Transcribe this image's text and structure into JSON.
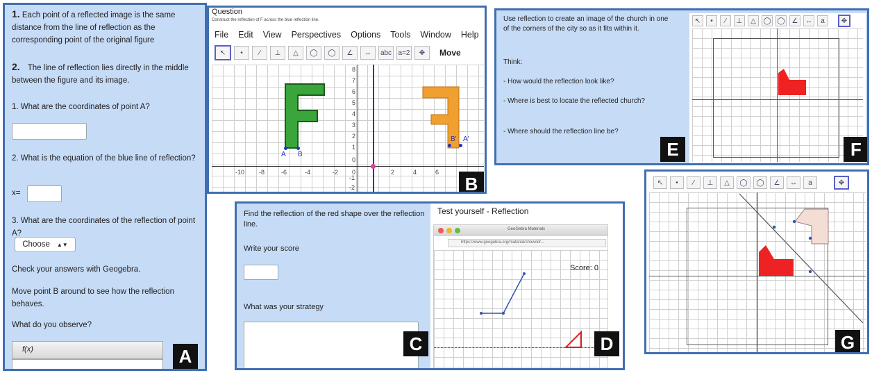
{
  "panelA": {
    "rule1": "Each point of a reflected image is the same distance from the line of reflection as the corresponding point of the original figure",
    "rule1_num": "1.",
    "rule2": "The line of reflection lies directly in the middle between the figure and its image.",
    "rule2_num": "2.",
    "q1": "1. What are the coordinates of point A?",
    "q2": "2. What is the equation of the blue line of reflection?",
    "q2_prefix": "x=",
    "q3": "3. What are the coordinates of the reflection of point A?",
    "choose": "Choose",
    "check": "Check your answers with Geogebra.",
    "move": "Move point B around to see how the reflection behaves.",
    "observe": "What do you observe?",
    "fx": "f(x)",
    "label": "A"
  },
  "panelB": {
    "title": "Question",
    "subtitle": "Construct the reflection of F across the blue reflection line.",
    "menu": [
      "File",
      "Edit",
      "View",
      "Perspectives",
      "Options",
      "Tools",
      "Window",
      "Help"
    ],
    "move_label": "Move",
    "x_ticks": [
      "-10",
      "-8",
      "-6",
      "-4",
      "-2",
      "0",
      "2",
      "4",
      "6"
    ],
    "y_ticks": [
      "8",
      "7",
      "6",
      "5",
      "4",
      "3",
      "2",
      "1",
      "0",
      "-1",
      "-2"
    ],
    "point_A": "A",
    "point_B": "B",
    "point_B_prime": "B'",
    "point_A_prime": "A'",
    "label": "B",
    "colors": {
      "figure": "#3aa53a",
      "image": "#f0a030",
      "line": "#2233cc"
    }
  },
  "panelC": {
    "prompt": "Find the reflection of the red shape over the reflection line.",
    "score_label": "Write your score",
    "strategy_label": "What was your strategy",
    "label": "C"
  },
  "panelD": {
    "title": "Test yourself - Reflection",
    "window_title": "GeoGebra Materials",
    "url": "https://www.geogebra.org/material/show/id/...",
    "score": "Score: 0",
    "label": "D"
  },
  "panelE": {
    "prompt": "Use reflection to create an image of the church in one of the corners of the city so as it fits within it.",
    "think": "Think:",
    "q1": "- How would the reflection look like?",
    "q2": "- Where is best to locate the reflected church?",
    "q3": "- Where should the reflection line be?",
    "label": "E"
  },
  "panelF": {
    "label": "F",
    "shape_color": "#ee2222"
  },
  "panelG": {
    "label": "G",
    "shape_color": "#ee2222",
    "image_color": "#f3ddd4"
  }
}
